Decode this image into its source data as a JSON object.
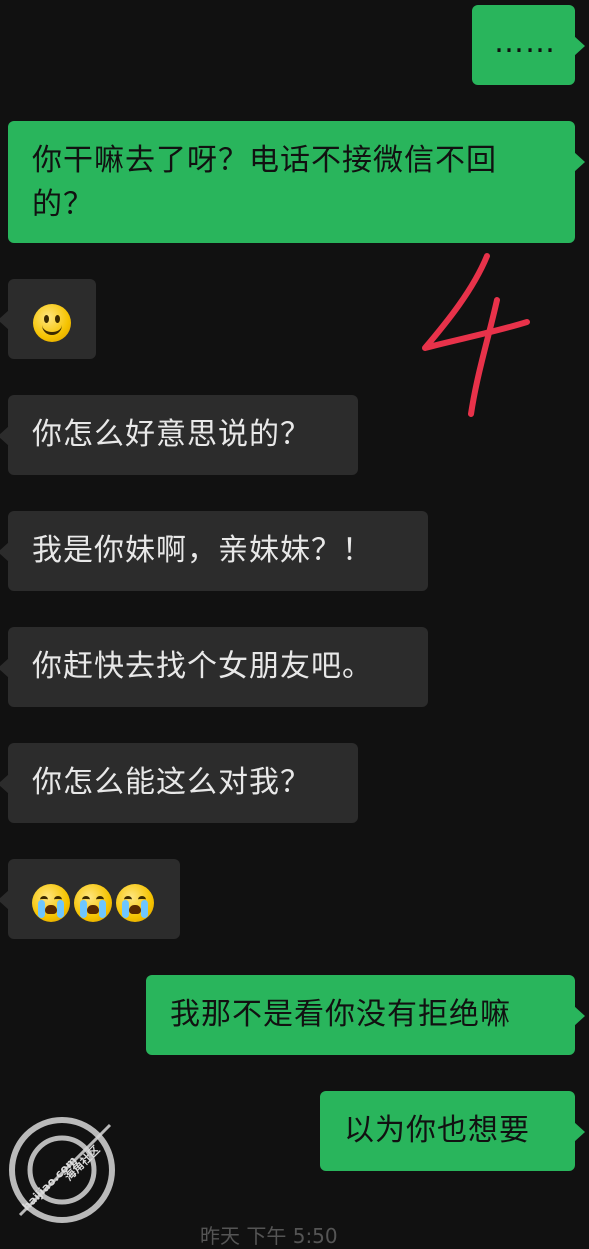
{
  "messages": [
    {
      "side": "sent",
      "text": "……"
    },
    {
      "side": "sent",
      "text": "你干嘛去了呀？电话不接微信不回的？"
    },
    {
      "side": "received",
      "emoji": "smile-emoji"
    },
    {
      "side": "received",
      "text": "你怎么好意思说的？"
    },
    {
      "side": "received",
      "text": "我是你妹啊，亲妹妹？！"
    },
    {
      "side": "received",
      "text": "你赶快去找个女朋友吧。"
    },
    {
      "side": "received",
      "text": "你怎么能这么对我？"
    },
    {
      "side": "received",
      "emoji": "crying-emoji",
      "count": 3
    },
    {
      "side": "sent",
      "text": "我那不是看你没有拒绝嘛"
    },
    {
      "side": "sent",
      "text": "以为你也想要"
    }
  ],
  "annotation": {
    "text": "4",
    "color": "#e8324a"
  },
  "watermark": {
    "site_name": "海角社区",
    "domain": "haijiao.com"
  },
  "timestamp_partial": "昨天 下午 5:50",
  "colors": {
    "background": "#111111",
    "sent_bubble": "#29b55c",
    "received_bubble": "#2c2c2c"
  }
}
